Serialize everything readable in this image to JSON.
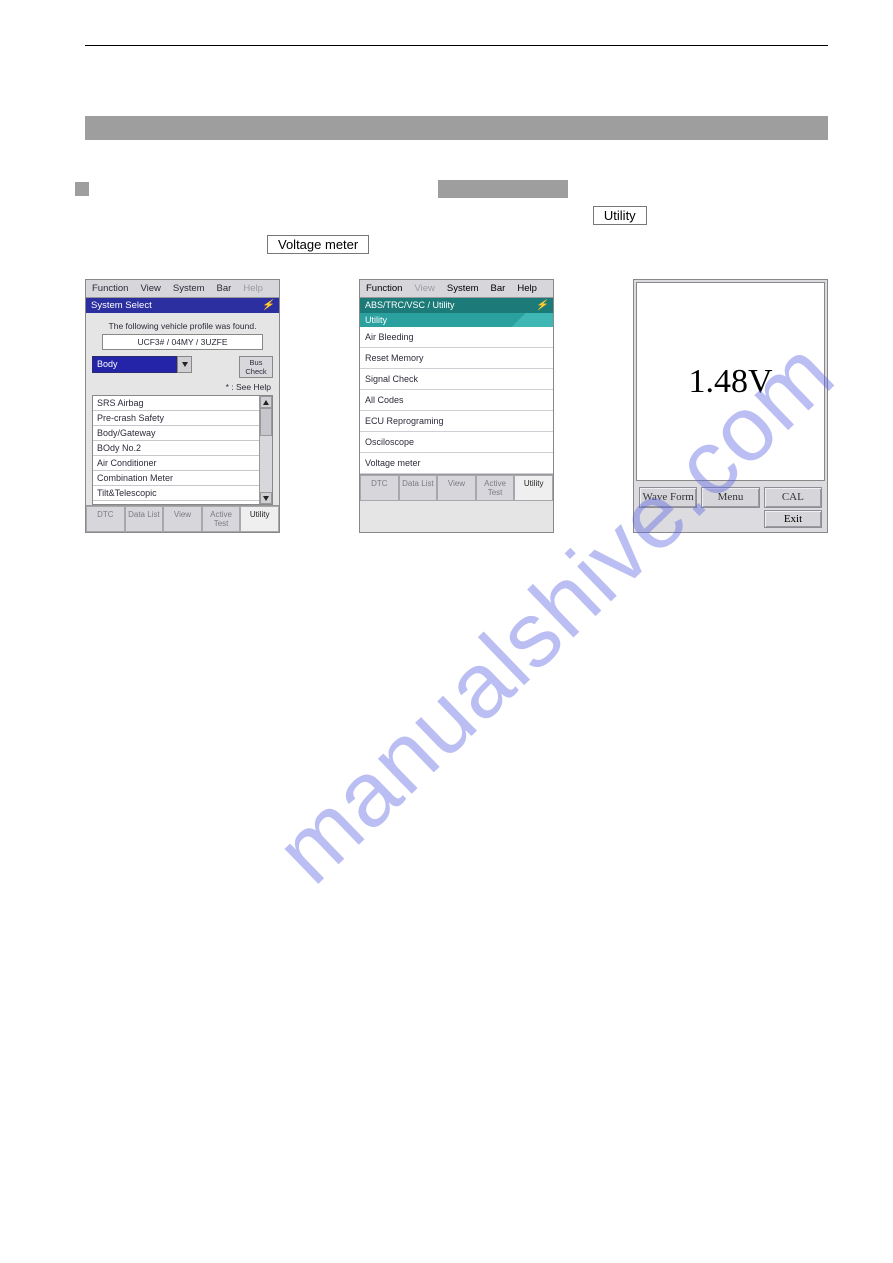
{
  "watermark": "manualshive.com",
  "instructions": {
    "utility_btn": "Utility",
    "voltage_meter_box": "Voltage meter"
  },
  "panel1": {
    "menu": [
      "Function",
      "View",
      "System",
      "Bar",
      "Help"
    ],
    "title": "System Select",
    "found": "The following vehicle profile was found.",
    "vehicle": "UCF3#   / 04MY / 3UZFE",
    "combo": "Body",
    "bus_check": "Bus Check",
    "see_help": "* : See Help",
    "list": [
      "SRS Airbag",
      "Pre-crash Safety",
      "Body/Gateway",
      "BOdy No.2",
      "Air Conditioner",
      "Combination Meter",
      "Tilt&Telescopic"
    ],
    "bottom": [
      "DTC",
      "Data List",
      "View",
      "Active Test",
      "Utility"
    ]
  },
  "panel2": {
    "menu": [
      "Function",
      "View",
      "System",
      "Bar",
      "Help"
    ],
    "title": "ABS/TRC/VSC / Utility",
    "utility_header": "Utility",
    "list": [
      "Air Bleeding",
      "Reset Memory",
      "Signal Check",
      "All Codes",
      "ECU Reprograming",
      "Osciloscope",
      "Voltage meter"
    ],
    "bottom": [
      "DTC",
      "Data List",
      "View",
      "Active Test",
      "Utility"
    ]
  },
  "panel3": {
    "voltage": "1.48V",
    "buttons": [
      "Wave Form",
      "Menu",
      "CAL"
    ],
    "exit": "Exit"
  }
}
